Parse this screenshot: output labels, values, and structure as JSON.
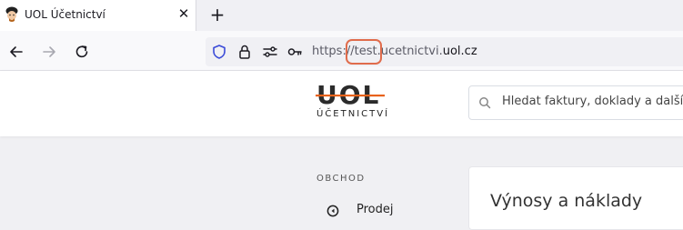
{
  "browser": {
    "tab": {
      "title": "UOL Účetnictví",
      "close_glyph": "✕"
    },
    "new_tab_glyph": "+",
    "address": {
      "scheme": "https://",
      "subdomain": "test.ucetnictvi.",
      "domain": "uol.cz"
    },
    "icons": [
      "back-icon",
      "forward-icon",
      "reload-icon",
      "shield-icon",
      "lock-icon",
      "permissions-icon",
      "key-icon"
    ]
  },
  "site": {
    "logo": {
      "word": "UOL",
      "subtitle": "ÚČETNICTVÍ",
      "accent_color": "#e8621a"
    },
    "search": {
      "placeholder": "Hledat faktury, doklady a další..."
    }
  },
  "sidebar": {
    "section": "OBCHOD",
    "items": [
      {
        "label": "Prodej",
        "icon": "circle-arrow-left-icon"
      }
    ]
  },
  "main": {
    "card_title": "Výnosy a náklady"
  },
  "colors": {
    "highlight_ring": "#e06c4c",
    "page_bg": "#f0f0f3"
  }
}
